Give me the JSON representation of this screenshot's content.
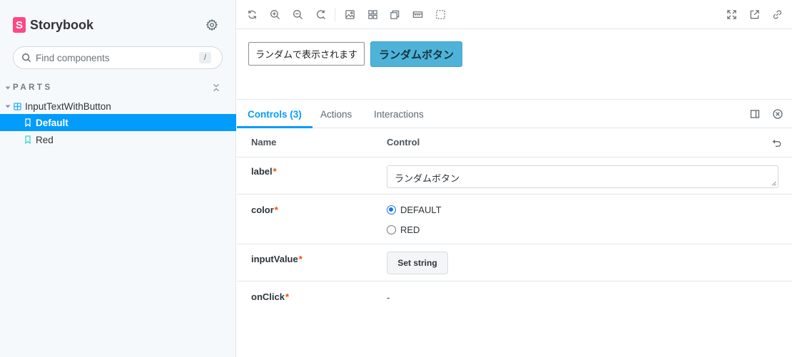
{
  "sidebar": {
    "brand": {
      "logo_letter": "S",
      "name": "Storybook"
    },
    "search": {
      "placeholder": "Find components",
      "shortcut": "/"
    },
    "section": {
      "label": "PARTS"
    },
    "component": {
      "label": "InputTextWithButton"
    },
    "stories": [
      {
        "label": "Default",
        "active": true
      },
      {
        "label": "Red",
        "active": false
      }
    ]
  },
  "toolbar": {
    "icons": [
      "reload-icon",
      "zoom-in-icon",
      "zoom-out-icon",
      "zoom-reset-icon",
      "background-icon",
      "grid-icon",
      "viewport-icon",
      "outline-measure-icon",
      "outline-icon",
      "fullscreen-icon",
      "open-new-tab-icon",
      "copy-link-icon"
    ]
  },
  "preview": {
    "input_value": "ランダムで表示されます",
    "button_label": "ランダムボタン",
    "button_color": "#4fb3d9"
  },
  "addons": {
    "tabs": [
      {
        "label": "Controls (3)",
        "active": true
      },
      {
        "label": "Actions",
        "active": false
      },
      {
        "label": "Interactions",
        "active": false
      }
    ]
  },
  "controls": {
    "header": {
      "name": "Name",
      "control": "Control"
    },
    "required_mark": "*",
    "rows": {
      "label": {
        "name": "label",
        "value": "ランダムボタン"
      },
      "color": {
        "name": "color",
        "options": [
          "DEFAULT",
          "RED"
        ],
        "selected": "DEFAULT"
      },
      "inputValue": {
        "name": "inputValue",
        "button": "Set string"
      },
      "onClick": {
        "name": "onClick",
        "value": "-"
      }
    }
  },
  "colors": {
    "accent": "#029cfd",
    "brand": "#ff4785",
    "required": "#ff4400"
  }
}
